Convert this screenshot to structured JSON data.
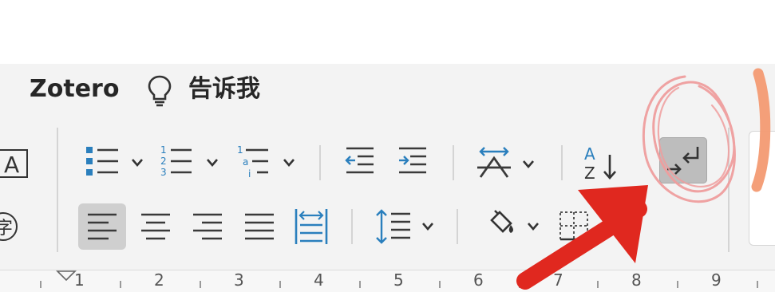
{
  "menu": {
    "zotero_label": "Zotero",
    "tell_me_label": "告诉我"
  },
  "left_partial": {
    "char_box_label": "A",
    "phonetic_label": "字"
  },
  "toolbar_row1": [
    {
      "icon": "bullets-icon",
      "has_dropdown": true
    },
    {
      "icon": "numbering-icon",
      "has_dropdown": true
    },
    {
      "icon": "multilevel-list-icon",
      "has_dropdown": true
    },
    {
      "icon": "decrease-indent-icon"
    },
    {
      "icon": "increase-indent-icon"
    },
    {
      "icon": "text-direction-icon",
      "has_dropdown": true
    },
    {
      "icon": "sort-icon",
      "label": "A Z"
    },
    {
      "icon": "show-formatting-marks-icon",
      "state": "pressed"
    }
  ],
  "toolbar_row2": [
    {
      "icon": "align-left-icon",
      "state": "pressed"
    },
    {
      "icon": "align-center-icon"
    },
    {
      "icon": "align-right-icon"
    },
    {
      "icon": "justify-icon"
    },
    {
      "icon": "distributed-icon"
    },
    {
      "icon": "line-spacing-icon",
      "has_dropdown": true
    },
    {
      "icon": "shading-icon",
      "has_dropdown": true
    },
    {
      "icon": "borders-icon"
    }
  ],
  "ruler": {
    "numbers": [
      "1",
      "2",
      "3",
      "4",
      "5",
      "6",
      "7",
      "8",
      "9"
    ]
  },
  "colors": {
    "icon_blue": "#2a7fbd",
    "icon_dark": "#3a3a3a",
    "annotation_red": "#e0281f",
    "annotation_pink": "#ee9d9d",
    "annotation_orange": "#f39a72"
  }
}
